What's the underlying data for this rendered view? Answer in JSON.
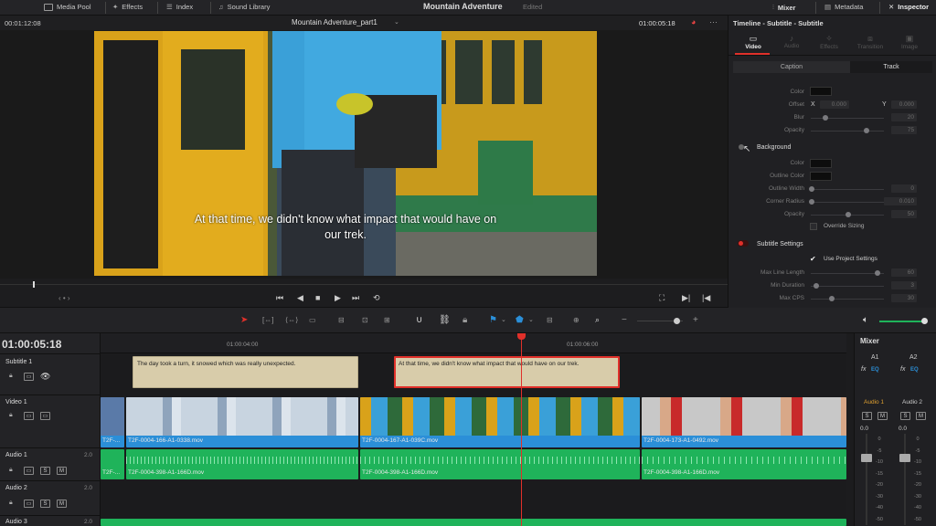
{
  "topbar": {
    "media_pool": "Media Pool",
    "effects": "Effects",
    "index": "Index",
    "sound_library": "Sound Library",
    "project_title": "Mountain Adventure",
    "edited": "Edited",
    "mixer": "Mixer",
    "metadata": "Metadata",
    "inspector": "Inspector"
  },
  "viewer": {
    "timecode_left": "00:01:12:08",
    "timeline_name": "Mountain Adventure_part1",
    "timecode_right": "01:00:05:18",
    "subtitle_line1": "At that time, we didn't know what impact that would have on",
    "subtitle_line2": "our trek."
  },
  "inspector": {
    "title": "Timeline - Subtitle - Subtitle",
    "tabs": [
      "Video",
      "Audio",
      "Effects",
      "Transition",
      "Image"
    ],
    "subtabs": [
      "Caption",
      "Track"
    ],
    "drop_shadow": {
      "color_label": "Color",
      "offset_label": "Offset",
      "x_label": "X",
      "x_value": "0.000",
      "y_label": "Y",
      "y_value": "0.000",
      "blur_label": "Blur",
      "blur_value": "20",
      "opacity_label": "Opacity",
      "opacity_value": "75"
    },
    "background": {
      "title": "Background",
      "color_label": "Color",
      "outline_color_label": "Outline Color",
      "outline_width_label": "Outline Width",
      "outline_width_value": "0",
      "corner_radius_label": "Corner Radius",
      "corner_radius_value": "0.010",
      "opacity_label": "Opacity",
      "opacity_value": "50",
      "override_sizing": "Override Sizing"
    },
    "subtitle_settings": {
      "title": "Subtitle Settings",
      "use_project": "Use Project Settings",
      "max_line_length_label": "Max Line Length",
      "max_line_length_value": "60",
      "min_duration_label": "Min Duration",
      "min_duration_value": "3",
      "max_cps_label": "Max CPS",
      "max_cps_value": "30"
    }
  },
  "timeline": {
    "timecode": "01:00:05:18",
    "ruler": [
      "01:00:04:00",
      "01:00:06:00"
    ],
    "tracks": {
      "subtitle1": "Subtitle 1",
      "video1": "Video 1",
      "audio1": "Audio 1",
      "audio1_level": "2.0",
      "audio2": "Audio 2",
      "audio2_level": "2.0",
      "audio3": "Audio 3",
      "audio3_level": "2.0"
    },
    "subtitle_clips": [
      "The day took a turn, it snowed which was really unexpected.",
      "At that time, we didn't know what impact that would have on our trek."
    ],
    "video_clips": [
      "T2F-...",
      "T2F-0004-166-A1-0338.mov",
      "T2F-0004-167-A1-039C.mov",
      "T2F-0004-173-A1-0492.mov"
    ],
    "audio_clips": [
      "T2F-...",
      "T2F-0004-398-A1-166D.mov",
      "T2F-0004-398-A1-166D.mov",
      "T2F-0004-398-A1-166D.mov"
    ]
  },
  "mixer": {
    "title": "Mixer",
    "channels": [
      "A1",
      "A2"
    ],
    "fx": "fx",
    "eq": "EQ",
    "strip_names": [
      "Audio 1",
      "Audio 2"
    ],
    "level": "0.0",
    "scale": [
      "0",
      "-5",
      "-10",
      "-15",
      "-20",
      "-30",
      "-40",
      "-50"
    ]
  },
  "colors": {
    "accent_red": "#e0302a",
    "subtitle_clip": "#d8ccaa",
    "video_clip": "#2b8fd8",
    "audio_clip": "#1fb35a",
    "playhead": "#e0302a"
  }
}
